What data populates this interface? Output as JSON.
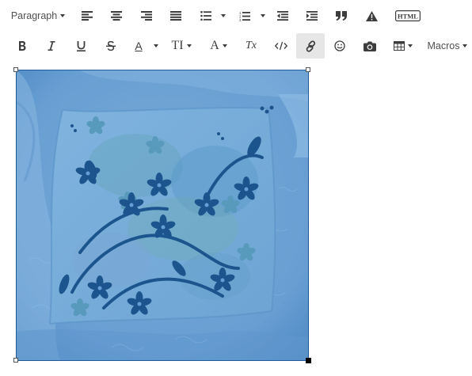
{
  "toolbar": {
    "paragraph_label": "Paragraph",
    "html_label": "HTML",
    "macros_label": "Macros",
    "text_color_letter": "A",
    "font_size_letter": "TI",
    "font_family_letter": "A",
    "clear_format_letter": "Tx"
  },
  "colors": {
    "accent_active": "#e6e6e6",
    "selection_border": "#1f5b9a",
    "selection_tint": "#1e78c8"
  },
  "image": {
    "subject": "floral-pillow-on-fur-blanket"
  }
}
